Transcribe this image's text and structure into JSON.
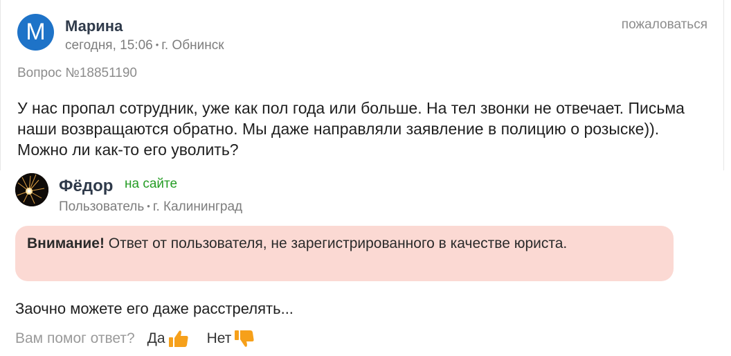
{
  "question": {
    "avatar_letter": "М",
    "author": "Марина",
    "date": "сегодня, 15:06",
    "city": "г. Обнинск",
    "report_label": "пожаловаться",
    "number": "Вопрос №18851190",
    "text": "У нас пропал сотрудник, уже как пол года или больше. На тел звонки не отвечает. Письма наши возвращаются обратно. Мы даже направляли заявление в полицию о розыске)). Можно ли как-то его уволить?"
  },
  "answer": {
    "author": "Фёдор",
    "status": "на сайте",
    "role": "Пользователь",
    "city": "г. Калининград",
    "warning_bold": "Внимание!",
    "warning_text": " Ответ от пользователя, не зарегистрированного в качестве юриста.",
    "text": "Заочно можете его даже расстрелять..."
  },
  "feedback": {
    "question": "Вам помог ответ?",
    "yes_label": "Да",
    "no_label": "Нет",
    "yes_icon": "thumbs-up-icon",
    "no_icon": "thumbs-down-icon"
  },
  "colors": {
    "accent_blue": "#1e73c8",
    "online_green": "#249c24",
    "warning_bg": "#fbd9d3",
    "thumb_orange": "#f6a01a"
  }
}
